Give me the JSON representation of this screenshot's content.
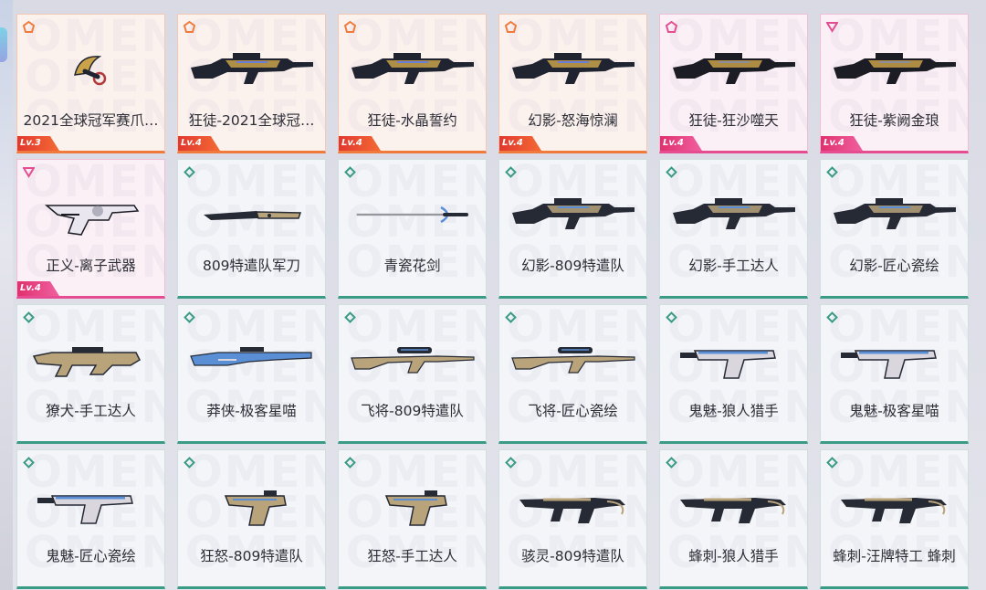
{
  "colors": {
    "orange_rarity": "#f07a3c",
    "pink_rarity": "#e64c92",
    "green_rarity": "#3a9c86",
    "level_badge_text": "#ffffff",
    "name_text": "#2d2d36"
  },
  "watermark_text": "OMEN",
  "skins": [
    {
      "name": "2021全球冠军赛爪…",
      "level": "Lv.3",
      "rarity": "orange",
      "tier_icon": "pentagon-tier-icon",
      "weapon": "karambit-knife"
    },
    {
      "name": "狂徒-2021全球冠…",
      "level": "Lv.4",
      "rarity": "orange",
      "tier_icon": "pentagon-tier-icon",
      "weapon": "rifle"
    },
    {
      "name": "狂徒-水晶誓约",
      "level": "Lv.4",
      "rarity": "orange",
      "tier_icon": "pentagon-tier-icon",
      "weapon": "rifle"
    },
    {
      "name": "幻影-怒海惊澜",
      "level": "Lv.4",
      "rarity": "orange",
      "tier_icon": "pentagon-tier-icon",
      "weapon": "rifle"
    },
    {
      "name": "狂徒-狂沙噬天",
      "level": "Lv.4",
      "rarity": "pink",
      "tier_icon": "pentagon-tier-icon",
      "weapon": "rifle"
    },
    {
      "name": "狂徒-紫阙金琅",
      "level": "Lv.4",
      "rarity": "pink",
      "tier_icon": "triangle-tier-icon",
      "weapon": "rifle"
    },
    {
      "name": "正义-离子武器",
      "level": "Lv.4",
      "rarity": "pink",
      "tier_icon": "triangle-tier-icon",
      "weapon": "revolver"
    },
    {
      "name": "809特遣队军刀",
      "level": "",
      "rarity": "green",
      "tier_icon": "diamond-tier-icon",
      "weapon": "knife"
    },
    {
      "name": "青瓷花剑",
      "level": "",
      "rarity": "green",
      "tier_icon": "diamond-tier-icon",
      "weapon": "rapier"
    },
    {
      "name": "幻影-809特遣队",
      "level": "",
      "rarity": "green",
      "tier_icon": "diamond-tier-icon",
      "weapon": "rifle"
    },
    {
      "name": "幻影-手工达人",
      "level": "",
      "rarity": "green",
      "tier_icon": "diamond-tier-icon",
      "weapon": "rifle"
    },
    {
      "name": "幻影-匠心瓷绘",
      "level": "",
      "rarity": "green",
      "tier_icon": "diamond-tier-icon",
      "weapon": "rifle"
    },
    {
      "name": "獠犬-手工达人",
      "level": "",
      "rarity": "green",
      "tier_icon": "diamond-tier-icon",
      "weapon": "bullpup"
    },
    {
      "name": "莽侠-极客星喵",
      "level": "",
      "rarity": "green",
      "tier_icon": "diamond-tier-icon",
      "weapon": "shotgun"
    },
    {
      "name": "飞将-809特遣队",
      "level": "",
      "rarity": "green",
      "tier_icon": "diamond-tier-icon",
      "weapon": "sniper"
    },
    {
      "name": "飞将-匠心瓷绘",
      "level": "",
      "rarity": "green",
      "tier_icon": "diamond-tier-icon",
      "weapon": "sniper"
    },
    {
      "name": "鬼魅-狼人猎手",
      "level": "",
      "rarity": "green",
      "tier_icon": "diamond-tier-icon",
      "weapon": "pistol"
    },
    {
      "name": "鬼魅-极客星喵",
      "level": "",
      "rarity": "green",
      "tier_icon": "diamond-tier-icon",
      "weapon": "pistol"
    },
    {
      "name": "鬼魅-匠心瓷绘",
      "level": "",
      "rarity": "green",
      "tier_icon": "diamond-tier-icon",
      "weapon": "pistol"
    },
    {
      "name": "狂怒-809特遣队",
      "level": "",
      "rarity": "green",
      "tier_icon": "diamond-tier-icon",
      "weapon": "machine-pistol"
    },
    {
      "name": "狂怒-手工达人",
      "level": "",
      "rarity": "green",
      "tier_icon": "diamond-tier-icon",
      "weapon": "machine-pistol"
    },
    {
      "name": "骇灵-809特遣队",
      "level": "",
      "rarity": "green",
      "tier_icon": "diamond-tier-icon",
      "weapon": "smg"
    },
    {
      "name": "蜂刺-狼人猎手",
      "level": "",
      "rarity": "green",
      "tier_icon": "diamond-tier-icon",
      "weapon": "smg"
    },
    {
      "name": "蜂刺-汪牌特工 蜂刺",
      "level": "",
      "rarity": "green",
      "tier_icon": "diamond-tier-icon",
      "weapon": "smg"
    }
  ]
}
